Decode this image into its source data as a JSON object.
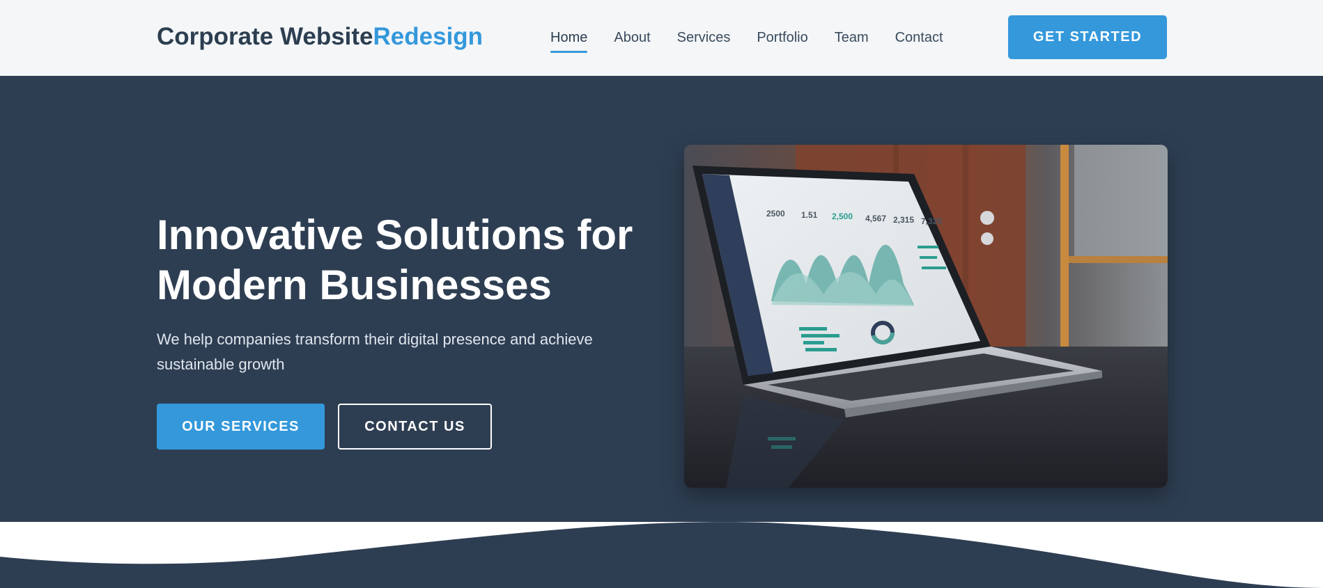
{
  "header": {
    "logo_main": "Corporate Website",
    "logo_accent": "Redesign",
    "nav": [
      {
        "label": "Home",
        "active": true
      },
      {
        "label": "About",
        "active": false
      },
      {
        "label": "Services",
        "active": false
      },
      {
        "label": "Portfolio",
        "active": false
      },
      {
        "label": "Team",
        "active": false
      },
      {
        "label": "Contact",
        "active": false
      }
    ],
    "cta_label": "GET STARTED"
  },
  "hero": {
    "title": "Innovative Solutions for Modern Businesses",
    "subtitle": "We help companies transform their digital presence and achieve sustainable growth",
    "primary_button": "OUR SERVICES",
    "secondary_button": "CONTACT US",
    "image_icon": "laptop-dashboard-photo"
  },
  "colors": {
    "brand_dark": "#2c3e50",
    "accent": "#3498db",
    "hero_bg": "#2e3e52",
    "header_bg": "#f4f6f8"
  }
}
